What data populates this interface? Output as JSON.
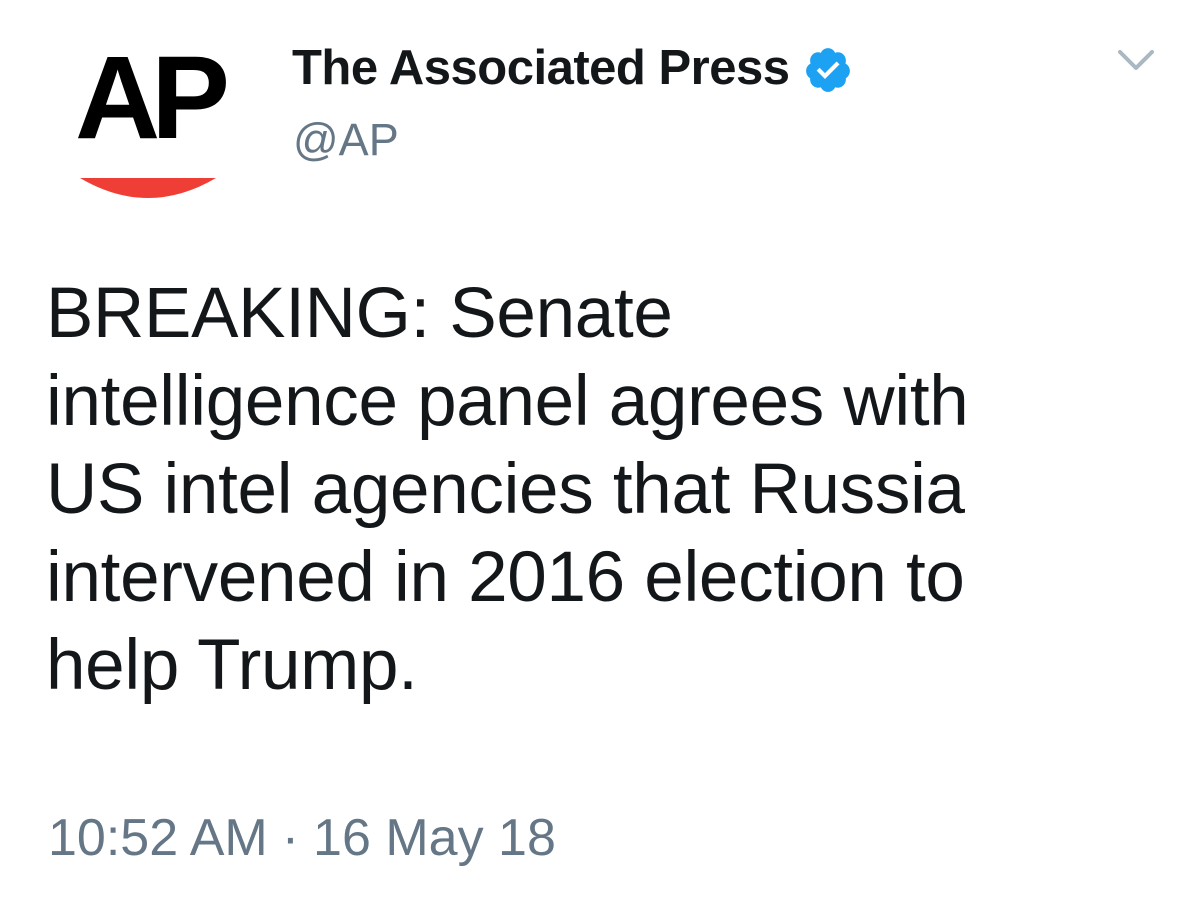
{
  "author": {
    "display_name": "The Associated Press",
    "handle": "@AP",
    "verified": true,
    "avatar_logo_text": "AP"
  },
  "tweet": {
    "text_lines": [
      "BREAKING: Senate",
      "intelligence panel agrees with",
      "US intel agencies that Russia",
      "intervened in 2016 election to",
      "help Trump."
    ],
    "time": "10:52 AM",
    "separator": "·",
    "date": "16 May 18"
  },
  "icons": {
    "verified": "verified-badge-icon",
    "menu": "chevron-down-icon"
  },
  "colors": {
    "text_primary": "#14171a",
    "text_secondary": "#657786",
    "verified_blue": "#1da1f2",
    "ap_red": "#ef3e36",
    "ap_black": "#000000"
  }
}
